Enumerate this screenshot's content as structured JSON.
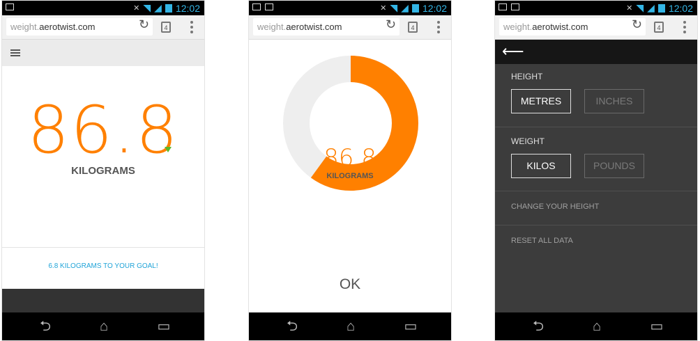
{
  "status_bar": {
    "time": "12:02",
    "left_icons": [
      "gmail-icon",
      "image-icon"
    ],
    "right_icons": [
      "silent-icon",
      "wifi-icon",
      "signal-icon",
      "battery-icon"
    ]
  },
  "browser": {
    "url_domain_prefix": "weight.",
    "url_domain": "aerotwist.com",
    "tab_count": "4"
  },
  "screen1": {
    "weight_value": "86.8",
    "unit_label": "KILOGRAMS",
    "goal_text": "6.8 KILOGRAMS TO YOUR GOAL!",
    "trend": "down"
  },
  "screen2": {
    "weight_value": "86.8",
    "unit_label": "KILOGRAMS",
    "progress_fraction": 0.6,
    "ok_label": "OK",
    "colors": {
      "progress": "#ff8000",
      "track": "#eeeeee"
    }
  },
  "screen3": {
    "height_label": "HEIGHT",
    "height_options": [
      "METRES",
      "INCHES"
    ],
    "height_selected": "METRES",
    "weight_label": "WEIGHT",
    "weight_options": [
      "KILOS",
      "POUNDS"
    ],
    "weight_selected": "KILOS",
    "change_height_label": "CHANGE YOUR HEIGHT",
    "reset_label": "RESET ALL DATA"
  },
  "colors": {
    "accent": "#ff8000",
    "goal_text": "#21a4d8",
    "trend_down": "#5cb82a",
    "status_time": "#33b5e5"
  }
}
